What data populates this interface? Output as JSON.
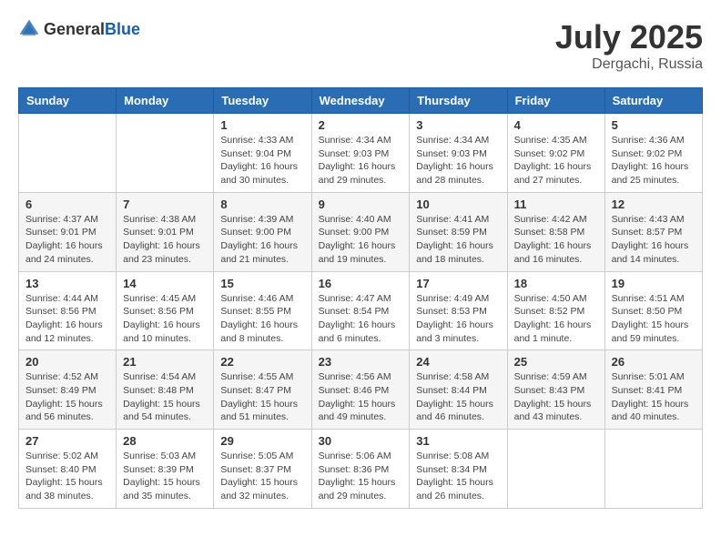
{
  "header": {
    "logo_general": "General",
    "logo_blue": "Blue",
    "title": "July 2025",
    "location": "Dergachi, Russia"
  },
  "calendar": {
    "days_of_week": [
      "Sunday",
      "Monday",
      "Tuesday",
      "Wednesday",
      "Thursday",
      "Friday",
      "Saturday"
    ],
    "weeks": [
      [
        {
          "day": "",
          "info": ""
        },
        {
          "day": "",
          "info": ""
        },
        {
          "day": "1",
          "info": "Sunrise: 4:33 AM\nSunset: 9:04 PM\nDaylight: 16 hours\nand 30 minutes."
        },
        {
          "day": "2",
          "info": "Sunrise: 4:34 AM\nSunset: 9:03 PM\nDaylight: 16 hours\nand 29 minutes."
        },
        {
          "day": "3",
          "info": "Sunrise: 4:34 AM\nSunset: 9:03 PM\nDaylight: 16 hours\nand 28 minutes."
        },
        {
          "day": "4",
          "info": "Sunrise: 4:35 AM\nSunset: 9:02 PM\nDaylight: 16 hours\nand 27 minutes."
        },
        {
          "day": "5",
          "info": "Sunrise: 4:36 AM\nSunset: 9:02 PM\nDaylight: 16 hours\nand 25 minutes."
        }
      ],
      [
        {
          "day": "6",
          "info": "Sunrise: 4:37 AM\nSunset: 9:01 PM\nDaylight: 16 hours\nand 24 minutes."
        },
        {
          "day": "7",
          "info": "Sunrise: 4:38 AM\nSunset: 9:01 PM\nDaylight: 16 hours\nand 23 minutes."
        },
        {
          "day": "8",
          "info": "Sunrise: 4:39 AM\nSunset: 9:00 PM\nDaylight: 16 hours\nand 21 minutes."
        },
        {
          "day": "9",
          "info": "Sunrise: 4:40 AM\nSunset: 9:00 PM\nDaylight: 16 hours\nand 19 minutes."
        },
        {
          "day": "10",
          "info": "Sunrise: 4:41 AM\nSunset: 8:59 PM\nDaylight: 16 hours\nand 18 minutes."
        },
        {
          "day": "11",
          "info": "Sunrise: 4:42 AM\nSunset: 8:58 PM\nDaylight: 16 hours\nand 16 minutes."
        },
        {
          "day": "12",
          "info": "Sunrise: 4:43 AM\nSunset: 8:57 PM\nDaylight: 16 hours\nand 14 minutes."
        }
      ],
      [
        {
          "day": "13",
          "info": "Sunrise: 4:44 AM\nSunset: 8:56 PM\nDaylight: 16 hours\nand 12 minutes."
        },
        {
          "day": "14",
          "info": "Sunrise: 4:45 AM\nSunset: 8:56 PM\nDaylight: 16 hours\nand 10 minutes."
        },
        {
          "day": "15",
          "info": "Sunrise: 4:46 AM\nSunset: 8:55 PM\nDaylight: 16 hours\nand 8 minutes."
        },
        {
          "day": "16",
          "info": "Sunrise: 4:47 AM\nSunset: 8:54 PM\nDaylight: 16 hours\nand 6 minutes."
        },
        {
          "day": "17",
          "info": "Sunrise: 4:49 AM\nSunset: 8:53 PM\nDaylight: 16 hours\nand 3 minutes."
        },
        {
          "day": "18",
          "info": "Sunrise: 4:50 AM\nSunset: 8:52 PM\nDaylight: 16 hours\nand 1 minute."
        },
        {
          "day": "19",
          "info": "Sunrise: 4:51 AM\nSunset: 8:50 PM\nDaylight: 15 hours\nand 59 minutes."
        }
      ],
      [
        {
          "day": "20",
          "info": "Sunrise: 4:52 AM\nSunset: 8:49 PM\nDaylight: 15 hours\nand 56 minutes."
        },
        {
          "day": "21",
          "info": "Sunrise: 4:54 AM\nSunset: 8:48 PM\nDaylight: 15 hours\nand 54 minutes."
        },
        {
          "day": "22",
          "info": "Sunrise: 4:55 AM\nSunset: 8:47 PM\nDaylight: 15 hours\nand 51 minutes."
        },
        {
          "day": "23",
          "info": "Sunrise: 4:56 AM\nSunset: 8:46 PM\nDaylight: 15 hours\nand 49 minutes."
        },
        {
          "day": "24",
          "info": "Sunrise: 4:58 AM\nSunset: 8:44 PM\nDaylight: 15 hours\nand 46 minutes."
        },
        {
          "day": "25",
          "info": "Sunrise: 4:59 AM\nSunset: 8:43 PM\nDaylight: 15 hours\nand 43 minutes."
        },
        {
          "day": "26",
          "info": "Sunrise: 5:01 AM\nSunset: 8:41 PM\nDaylight: 15 hours\nand 40 minutes."
        }
      ],
      [
        {
          "day": "27",
          "info": "Sunrise: 5:02 AM\nSunset: 8:40 PM\nDaylight: 15 hours\nand 38 minutes."
        },
        {
          "day": "28",
          "info": "Sunrise: 5:03 AM\nSunset: 8:39 PM\nDaylight: 15 hours\nand 35 minutes."
        },
        {
          "day": "29",
          "info": "Sunrise: 5:05 AM\nSunset: 8:37 PM\nDaylight: 15 hours\nand 32 minutes."
        },
        {
          "day": "30",
          "info": "Sunrise: 5:06 AM\nSunset: 8:36 PM\nDaylight: 15 hours\nand 29 minutes."
        },
        {
          "day": "31",
          "info": "Sunrise: 5:08 AM\nSunset: 8:34 PM\nDaylight: 15 hours\nand 26 minutes."
        },
        {
          "day": "",
          "info": ""
        },
        {
          "day": "",
          "info": ""
        }
      ]
    ]
  }
}
